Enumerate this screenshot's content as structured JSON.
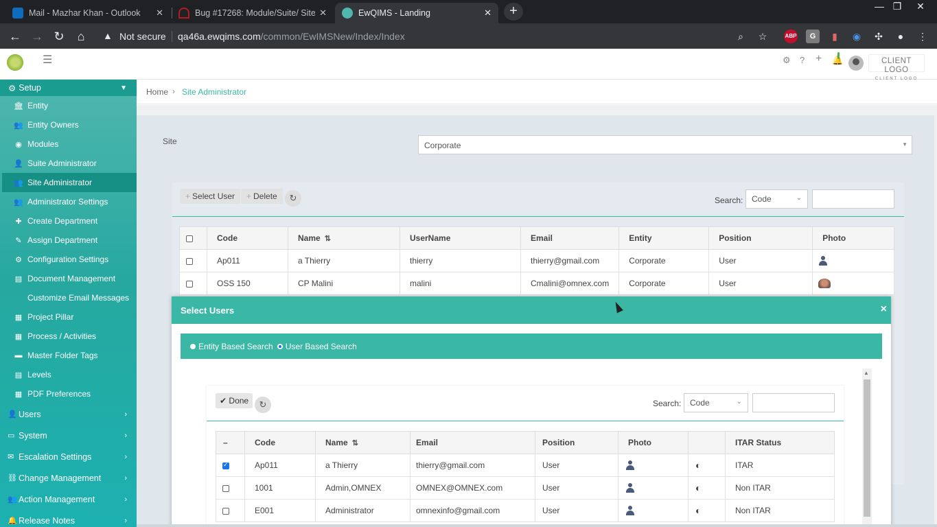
{
  "browser": {
    "tabs": [
      {
        "title": "Mail - Mazhar Khan - Outlook",
        "favicon_color": "#0f6cbd"
      },
      {
        "title": "Bug #17268: Module/Suite/ Site",
        "favicon_color": "#b21e1e"
      },
      {
        "title": "EwQIMS - Landing",
        "favicon_color": "#4fb7ae",
        "active": true
      }
    ],
    "close_glyph": "✕",
    "new_tab": "+",
    "window_controls": [
      "—",
      "❐",
      "✕"
    ],
    "security_label": "Not secure",
    "url_host": "qa46a.ewqims.com",
    "url_path": "/common/EwIMSNew/Index/Index",
    "ext_abp": "ABP",
    "ext_g": "G"
  },
  "header": {
    "client_logo": "CLIENT LOGO",
    "client_logo_sub": "CLIENT LOGO"
  },
  "sidebar": {
    "section": "Setup",
    "items": [
      {
        "label": "Entity",
        "icon": "bank-icon",
        "glyph": "🏛"
      },
      {
        "label": "Entity Owners",
        "icon": "users-icon",
        "glyph": "👥"
      },
      {
        "label": "Modules",
        "icon": "globe-icon",
        "glyph": "◉"
      },
      {
        "label": "Suite Administrator",
        "icon": "user-icon",
        "glyph": "👤"
      },
      {
        "label": "Site Administrator",
        "icon": "users-icon",
        "glyph": "👥",
        "active": true
      },
      {
        "label": "Administrator Settings",
        "icon": "users-gear-icon",
        "glyph": "👥"
      },
      {
        "label": "Create Department",
        "icon": "plus-icon",
        "glyph": "✚"
      },
      {
        "label": "Assign Department",
        "icon": "pencil-icon",
        "glyph": "✎"
      },
      {
        "label": "Configuration Settings",
        "icon": "gear-icon",
        "glyph": "⚙"
      },
      {
        "label": "Document Management",
        "icon": "document-icon",
        "glyph": "▤"
      },
      {
        "label": "Customize Email Messages",
        "icon": "",
        "glyph": ""
      },
      {
        "label": "Project Pillar",
        "icon": "building-icon",
        "glyph": "▦"
      },
      {
        "label": "Process / Activities",
        "icon": "building-icon",
        "glyph": "▦"
      },
      {
        "label": "Master Folder Tags",
        "icon": "folder-icon",
        "glyph": "▬"
      },
      {
        "label": "Levels",
        "icon": "document-icon",
        "glyph": "▤"
      },
      {
        "label": "PDF Preferences",
        "icon": "building-icon",
        "glyph": "▦"
      }
    ],
    "main": [
      {
        "label": "Users",
        "icon": "user-icon",
        "glyph": "👤"
      },
      {
        "label": "System",
        "icon": "monitor-icon",
        "glyph": "▭"
      },
      {
        "label": "Escalation Settings",
        "icon": "envelope-icon",
        "glyph": "✉"
      },
      {
        "label": "Change Management",
        "icon": "sitemap-icon",
        "glyph": "⛓"
      },
      {
        "label": "Action Management",
        "icon": "users-icon",
        "glyph": "👥"
      },
      {
        "label": "Release Notes",
        "icon": "bell-icon",
        "glyph": "🔔"
      }
    ]
  },
  "breadcrumb": {
    "home": "Home",
    "sep": "›",
    "current": "Site Administrator"
  },
  "site": {
    "label": "Site",
    "value": "Corporate"
  },
  "admin_toolbar": {
    "select_user": "Select User",
    "delete": "Delete",
    "search_label": "Search:",
    "search_field": "Code"
  },
  "admin_table": {
    "columns": [
      "Code",
      "Name",
      "UserName",
      "Email",
      "Entity",
      "Position",
      "Photo"
    ],
    "rows": [
      {
        "code": "Ap011",
        "name": "a Thierry",
        "username": "thierry",
        "email": "thierry@gmail.com",
        "entity": "Corporate",
        "position": "User",
        "photo": "avatar"
      },
      {
        "code": "OSS 150",
        "name": "CP Malini",
        "username": "malini",
        "email": "Cmalini@omnex.com",
        "entity": "Corporate",
        "position": "User",
        "photo": "picture"
      }
    ]
  },
  "modal": {
    "title": "Select Users",
    "close": "×",
    "radio_entity": "Entity Based Search",
    "radio_user": "User Based Search",
    "done": "Done",
    "search_label": "Search:",
    "search_field": "Code",
    "columns": [
      "–",
      "Code",
      "Name",
      "Email",
      "Position",
      "Photo",
      "",
      "ITAR Status"
    ],
    "rows": [
      {
        "checked": true,
        "code": "Ap011",
        "name": "a Thierry",
        "email": "thierry@gmail.com",
        "position": "User",
        "itar": "ITAR"
      },
      {
        "checked": false,
        "code": "1001",
        "name": "Admin,OMNEX",
        "email": "OMNEX@OMNEX.com",
        "position": "User",
        "itar": "Non ITAR"
      },
      {
        "checked": false,
        "code": "E001",
        "name": "Administrator",
        "email": "omnexinfo@gmail.com",
        "position": "User",
        "itar": "Non ITAR"
      }
    ]
  }
}
